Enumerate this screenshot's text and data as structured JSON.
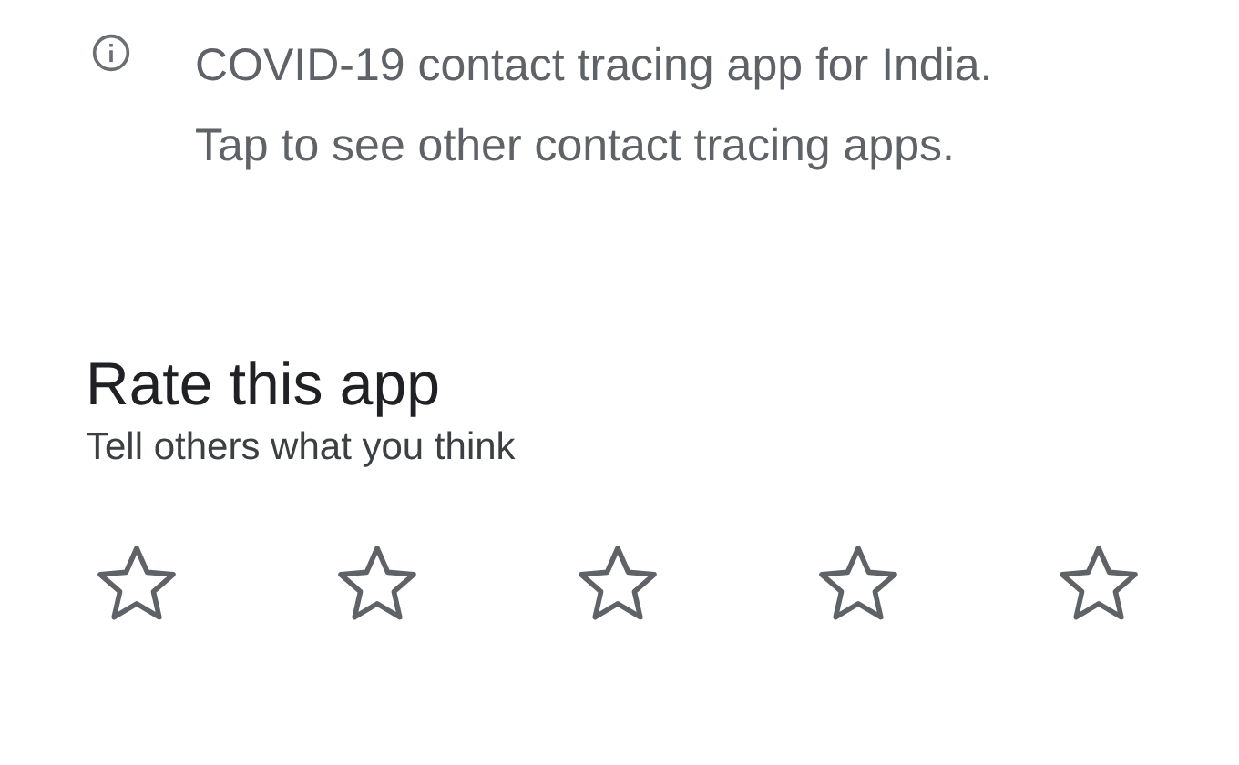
{
  "notice": {
    "text": "COVID-19 contact tracing app for India. Tap to see other contact tracing apps."
  },
  "rating": {
    "title": "Rate this app",
    "subtitle": "Tell others what you think",
    "stars": 0
  }
}
